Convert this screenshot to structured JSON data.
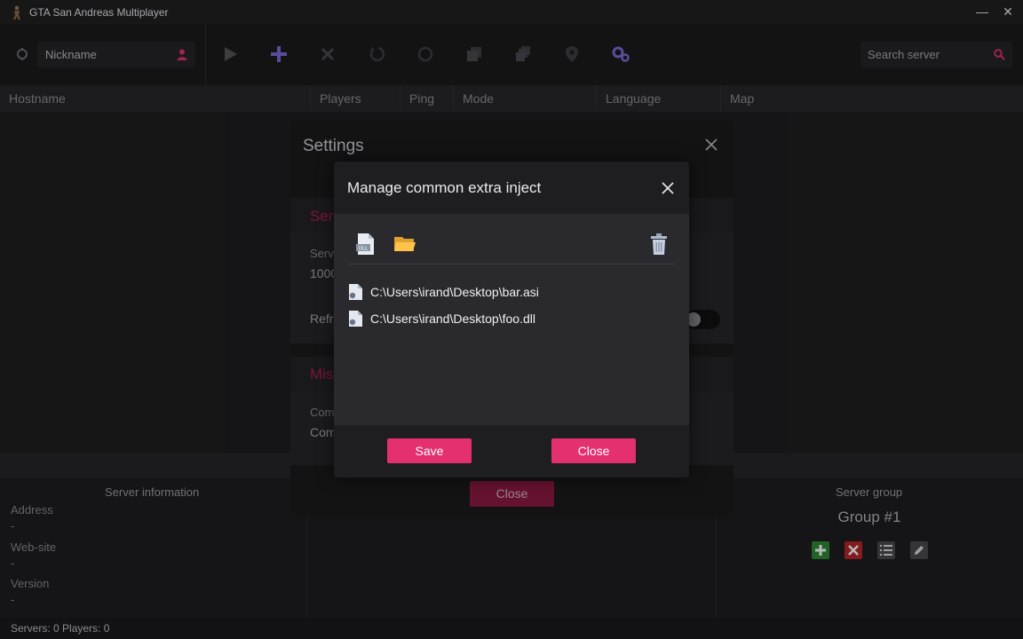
{
  "app": {
    "title": "GTA San Andreas Multiplayer",
    "window_buttons": {
      "minimize": "—",
      "close": "✕"
    }
  },
  "toolbar": {
    "nickname_placeholder": "Nickname",
    "search_placeholder": "Search server",
    "icons": [
      "refresh-icon",
      "user-icon",
      "play-icon",
      "add-icon",
      "delete-icon",
      "refresh-rotate-icon",
      "sync-icon",
      "copy-icon",
      "copy-multi-icon",
      "location-icon",
      "settings-gears-icon",
      "search-icon"
    ]
  },
  "columns": [
    "Hostname",
    "Players",
    "Ping",
    "Mode",
    "Language",
    "Map"
  ],
  "server_info": {
    "heading": "Server information",
    "address_label": "Address",
    "address_value": "-",
    "website_label": "Web-site",
    "website_value": "-",
    "version_label": "Version",
    "version_value": "-"
  },
  "server_group": {
    "heading": "Server group",
    "name": "Group #1"
  },
  "status": {
    "text": "Servers: 0   Players: 0"
  },
  "settings": {
    "title": "Settings",
    "section1_title": "Ser",
    "field1_label": "Serv",
    "field1_value": "1000",
    "field2_label": "Refr",
    "section2_title": "Mis",
    "field3_label": "Com",
    "field3_value": "Com",
    "close_button": "Close"
  },
  "modal": {
    "title": "Manage common extra inject",
    "files": [
      "C:\\Users\\irand\\Desktop\\bar.asi",
      "C:\\Users\\irand\\Desktop\\foo.dll"
    ],
    "dll_icon_text": "DLL",
    "save_button": "Save",
    "close_button": "Close"
  },
  "colors": {
    "accent": "#e4306f",
    "accent_dim": "#8d1a43",
    "section_title": "#b01d50",
    "toolbar_active_icon": "#7b6bd6"
  }
}
